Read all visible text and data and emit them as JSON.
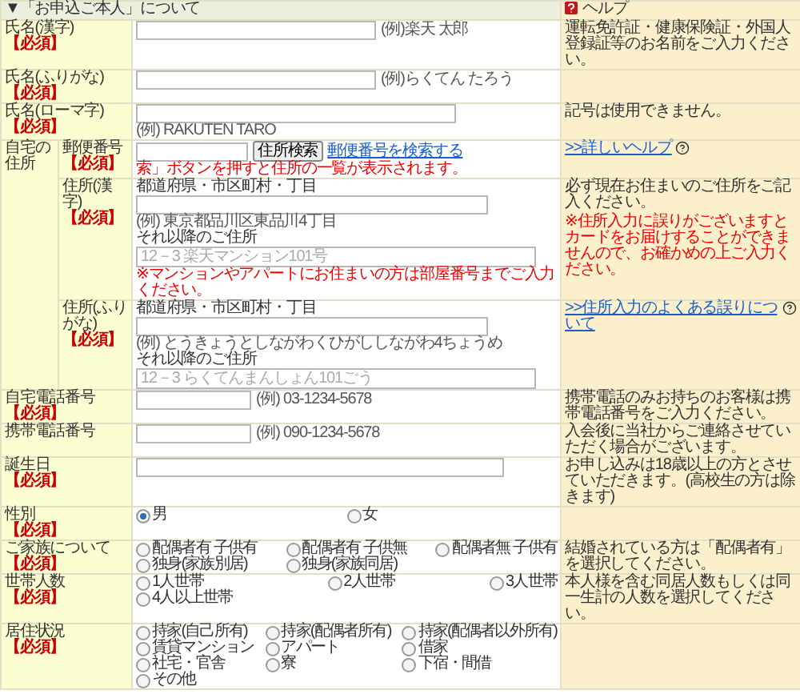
{
  "header": {
    "title": "▼「お申込ご本人」について",
    "help_title": "ヘルプ"
  },
  "rows": [
    {
      "kind": "inline",
      "label": "氏名(漢字)",
      "badge": "【必須】",
      "example": "(例)楽天 太郎",
      "help": [
        {
          "kind": "text",
          "text": "運転免許証・健康保険証・外国人登録証等のお名前をご入力ください。"
        }
      ]
    },
    {
      "kind": "inline",
      "label": "氏名(ふりがな)",
      "badge": "【必須】",
      "example": "(例)らくてん たろう"
    },
    {
      "kind": "stacked",
      "label": "氏名(ローマ字)",
      "badge": "【必須】",
      "example": "(例) RAKUTEN TARO",
      "help": [
        {
          "kind": "text",
          "text": "記号は使用できません。"
        }
      ]
    },
    {
      "kind": "address",
      "label": "自宅の住所",
      "parts": [
        {
          "kind": "zip",
          "label": "郵便番号",
          "badge": "【必須】",
          "button": "住所検索",
          "link": "郵便番号を検索する",
          "note": "索」ボタンを押すと住所の一覧が表示されます。",
          "help": [
            {
              "kind": "link",
              "text": ">>詳しいヘルプ"
            }
          ]
        },
        {
          "kind": "lines",
          "label": "住所(漢字)",
          "badge": "【必須】",
          "line1_label": "都道府県・市区町村・丁目",
          "example": "(例) 東京都品川区東品川4丁目",
          "line2_label": "それ以降のご住所",
          "line2_placeholder": "12－3 楽天マンション101号",
          "note": "※マンションやアパートにお住まいの方は部屋番号までご入力ください。",
          "help": [
            {
              "kind": "text",
              "text": "必ず現在お住まいのご住所をご記入ください。"
            },
            {
              "kind": "warning",
              "text": "※住所入力に誤りがございますとカードをお届けすることができませんので、お確かめの上ご入力ください。"
            }
          ]
        },
        {
          "kind": "lines",
          "label": "住所(ふりがな)",
          "badge": "【必須】",
          "line1_label": "都道府県・市区町村・丁目",
          "example": "(例) とうきょうとしながわくひがししながわ4ちょうめ",
          "line2_label": "それ以降のご住所",
          "line2_placeholder": "12－3 らくてんまんしょん101ごう",
          "help": [
            {
              "kind": "link",
              "text": ">>住所入力のよくある誤りについて"
            }
          ]
        }
      ]
    },
    {
      "kind": "phone",
      "label": "自宅電話番号",
      "badge": "【必須】",
      "example": "(例) 03-1234-5678",
      "help": [
        {
          "kind": "text",
          "text": "携帯電話のみお持ちのお客様は携帯電話番号をご入力ください。"
        }
      ]
    },
    {
      "kind": "phone",
      "label": "携帯電話番号",
      "example": "(例) 090-1234-5678",
      "help": [
        {
          "kind": "text",
          "text": "入会後に当社からご連絡させていただく場合がございます。"
        }
      ]
    },
    {
      "kind": "select",
      "label": "誕生日",
      "badge": "【必須】",
      "help": [
        {
          "kind": "text",
          "text": "お申し込みは18歳以上の方とさせていただきます。(高校生の方は除きます)"
        }
      ]
    },
    {
      "kind": "radio",
      "label": "性別",
      "badge": "【必須】",
      "options": [
        {
          "label": "男",
          "selected": true
        },
        {
          "label": "女",
          "selected": false
        }
      ]
    },
    {
      "kind": "radio",
      "label": "ご家族について",
      "badge": "【必須】",
      "options": [
        {
          "label": "配偶者有 子供有",
          "selected": false
        },
        {
          "label": "配偶者有 子供無",
          "selected": false
        },
        {
          "label": "配偶者無 子供有",
          "selected": false
        },
        {
          "label": "独身(家族別居)",
          "selected": false
        },
        {
          "label": "独身(家族同居)",
          "selected": false
        }
      ],
      "help": [
        {
          "kind": "text",
          "text": "結婚されている方は「配偶者有」を選択してください。"
        }
      ]
    },
    {
      "kind": "radio",
      "label": "世帯人数",
      "badge": "【必須】",
      "options": [
        {
          "label": "1人世帯",
          "selected": false
        },
        {
          "label": "2人世帯",
          "selected": false
        },
        {
          "label": "3人世帯",
          "selected": false
        },
        {
          "label": "4人以上世帯",
          "selected": false
        }
      ],
      "help": [
        {
          "kind": "text",
          "text": "本人様を含む同居人数もしくは同一生計の人数を選択してください。"
        }
      ]
    },
    {
      "kind": "radio",
      "label": "居住状況",
      "badge": "【必須】",
      "options": [
        {
          "label": "持家(自己所有)",
          "selected": false
        },
        {
          "label": "持家(配偶者所有)",
          "selected": false
        },
        {
          "label": "持家(配偶者以外所有)",
          "selected": false
        },
        {
          "label": "賃貸マンション",
          "selected": false
        },
        {
          "label": "アパート",
          "selected": false
        },
        {
          "label": "借家",
          "selected": false
        },
        {
          "label": "社宅・官舎",
          "selected": false
        },
        {
          "label": "寮",
          "selected": false
        },
        {
          "label": "下宿・間借",
          "selected": false
        },
        {
          "label": "その他",
          "selected": false
        }
      ]
    }
  ]
}
